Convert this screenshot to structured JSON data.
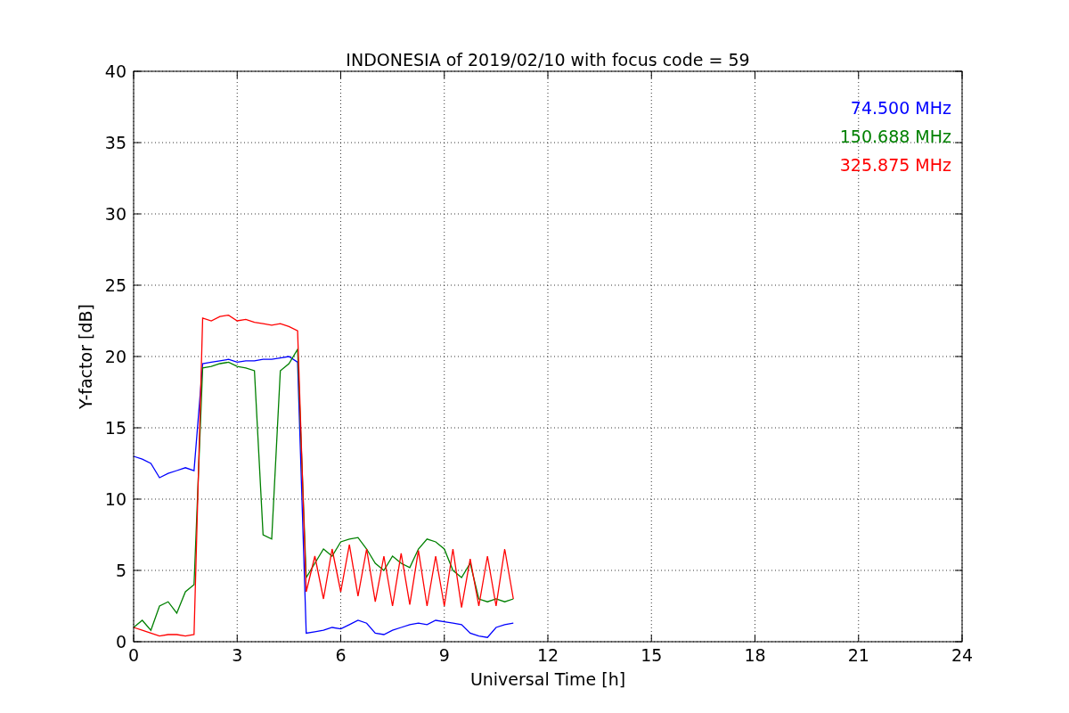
{
  "chart_data": {
    "type": "line",
    "title": "INDONESIA of 2019/02/10 with focus code = 59",
    "xlabel": "Universal Time [h]",
    "ylabel": "Y-factor [dB]",
    "x": [
      0,
      0.25,
      0.5,
      0.75,
      1,
      1.25,
      1.5,
      1.75,
      2,
      2.25,
      2.5,
      2.75,
      3,
      3.25,
      3.5,
      3.75,
      4,
      4.25,
      4.5,
      4.75,
      5,
      5.25,
      5.5,
      5.75,
      6,
      6.25,
      6.5,
      6.75,
      7,
      7.25,
      7.5,
      7.75,
      8,
      8.25,
      8.5,
      8.75,
      9,
      9.25,
      9.5,
      9.75,
      10,
      10.25,
      10.5,
      10.75,
      11
    ],
    "series": [
      {
        "name": "74.500 MHz",
        "color": "#0000ff",
        "values": [
          13,
          12.8,
          12.5,
          11.5,
          11.8,
          12,
          12.2,
          12,
          19.5,
          19.6,
          19.7,
          19.8,
          19.6,
          19.7,
          19.7,
          19.8,
          19.8,
          19.9,
          20,
          19.6,
          0.6,
          0.7,
          0.8,
          1,
          0.9,
          1.2,
          1.5,
          1.3,
          0.6,
          0.5,
          0.8,
          1,
          1.2,
          1.3,
          1.2,
          1.5,
          1.4,
          1.3,
          1.2,
          0.6,
          0.4,
          0.3,
          1,
          1.2,
          1.3
        ]
      },
      {
        "name": "150.688 MHz",
        "color": "#008000",
        "values": [
          1,
          1.5,
          0.8,
          2.5,
          2.8,
          2,
          3.5,
          4,
          19.2,
          19.3,
          19.5,
          19.6,
          19.3,
          19.2,
          19,
          7.5,
          7.2,
          19,
          19.5,
          20.5,
          4.5,
          5.5,
          6.5,
          6,
          7,
          7.2,
          7.3,
          6.5,
          5.5,
          5,
          6,
          5.5,
          5.2,
          6.5,
          7.2,
          7,
          6.5,
          5,
          4.5,
          5.5,
          3,
          2.8,
          3,
          2.8,
          3
        ]
      },
      {
        "name": "325.875 MHz",
        "color": "#ff0000",
        "values": [
          1,
          0.8,
          0.6,
          0.4,
          0.5,
          0.5,
          0.4,
          0.5,
          22.7,
          22.5,
          22.8,
          22.9,
          22.5,
          22.6,
          22.4,
          22.3,
          22.2,
          22.3,
          22.1,
          21.8,
          3.5,
          6,
          3,
          6.5,
          3.5,
          6.8,
          3.2,
          6.5,
          2.8,
          6,
          2.5,
          6.2,
          2.6,
          6.4,
          2.5,
          6,
          2.5,
          6.5,
          2.4,
          5.8,
          2.5,
          6,
          2.5,
          6.5,
          3
        ]
      }
    ],
    "xlim": [
      0,
      24
    ],
    "ylim": [
      0,
      40
    ],
    "xticks": [
      0,
      3,
      6,
      9,
      12,
      15,
      18,
      21,
      24
    ],
    "yticks": [
      0,
      5,
      10,
      15,
      20,
      25,
      30,
      35,
      40
    ],
    "grid": true
  }
}
